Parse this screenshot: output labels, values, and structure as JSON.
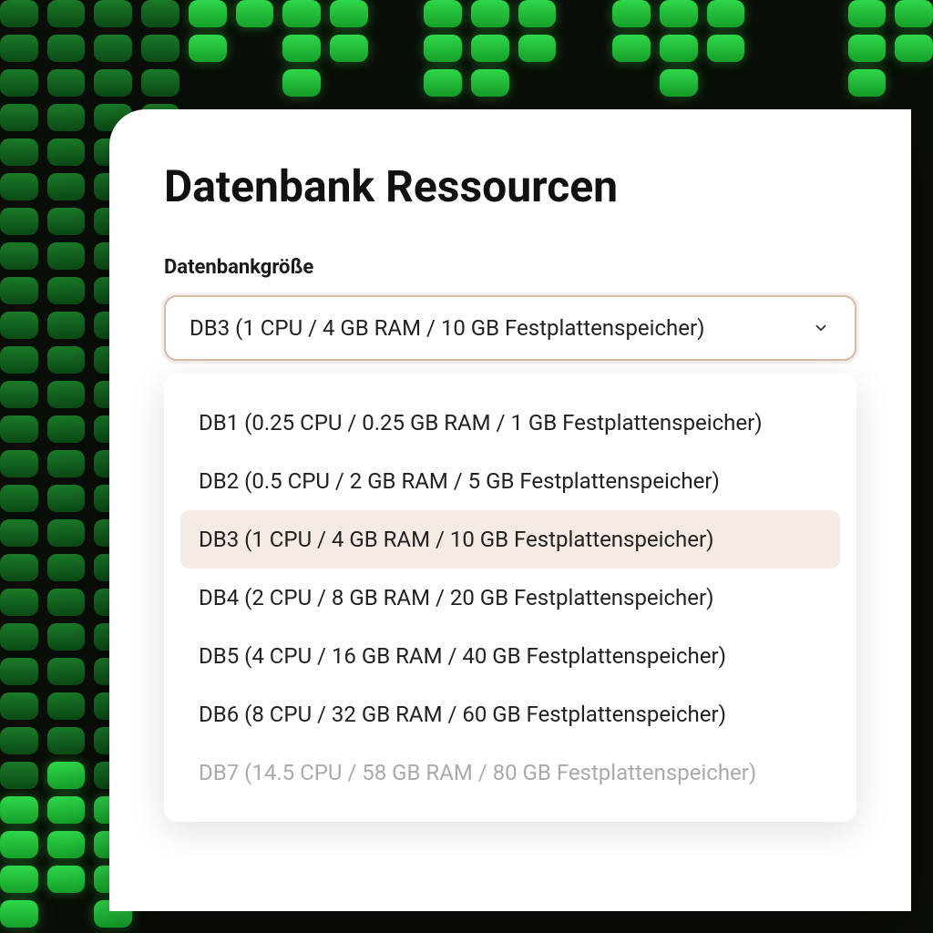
{
  "title": "Datenbank Ressourcen",
  "field_label": "Datenbankgröße",
  "selected_value": "DB3 (1 CPU / 4 GB RAM / 10 GB Festplattenspeicher)",
  "options": [
    {
      "label": "DB1 (0.25 CPU / 0.25 GB RAM / 1 GB Festplattenspeicher)",
      "selected": false,
      "faded": false
    },
    {
      "label": "DB2 (0.5 CPU / 2 GB RAM / 5 GB Festplattenspeicher)",
      "selected": false,
      "faded": false
    },
    {
      "label": "DB3 (1 CPU / 4 GB RAM / 10 GB Festplattenspeicher)",
      "selected": true,
      "faded": false
    },
    {
      "label": "DB4 (2 CPU / 8 GB RAM / 20 GB Festplattenspeicher)",
      "selected": false,
      "faded": false
    },
    {
      "label": "DB5 (4 CPU / 16 GB RAM / 40 GB Festplattenspeicher)",
      "selected": false,
      "faded": false
    },
    {
      "label": "DB6 (8 CPU / 32 GB RAM / 60 GB Festplattenspeicher)",
      "selected": false,
      "faded": false
    },
    {
      "label": "DB7 (14.5 CPU / 58 GB RAM / 80 GB Festplattenspeicher)",
      "selected": false,
      "faded": true
    }
  ]
}
